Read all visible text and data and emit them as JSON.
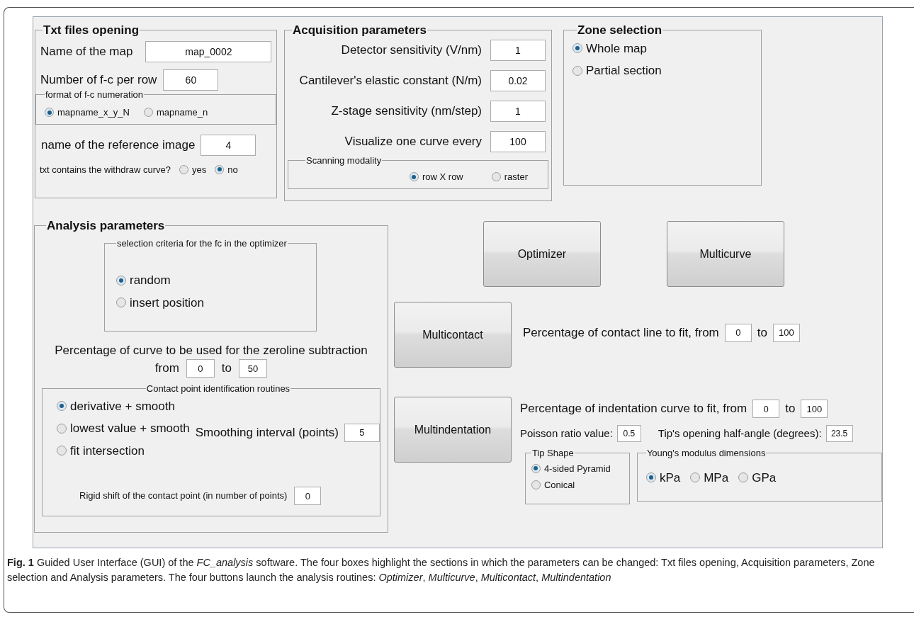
{
  "txt_files": {
    "title": "Txt files opening",
    "map_name": {
      "label": "Name of the map",
      "value": "map_0002"
    },
    "per_row": {
      "label": "Number of f-c per row",
      "value": "60"
    },
    "numeration": {
      "title": "format of f-c numeration",
      "options": [
        {
          "label": "mapname_x_y_N",
          "selected": true
        },
        {
          "label": "mapname_n",
          "selected": false
        }
      ]
    },
    "reference": {
      "label": "name of the reference image",
      "value": "4"
    },
    "withdraw": {
      "label": "txt contains the withdraw curve?",
      "options": [
        {
          "label": "yes",
          "selected": false
        },
        {
          "label": "no",
          "selected": true
        }
      ]
    }
  },
  "acquisition": {
    "title": "Acquisition parameters",
    "fields": [
      {
        "label": "Detector sensitivity (V/nm)",
        "value": "1"
      },
      {
        "label": "Cantilever's elastic constant (N/m)",
        "value": "0.02"
      },
      {
        "label": "Z-stage sensitivity (nm/step)",
        "value": "1"
      },
      {
        "label": "Visualize one curve every",
        "value": "100"
      }
    ],
    "scanning": {
      "title": "Scanning modality",
      "options": [
        {
          "label": "row X row",
          "selected": true
        },
        {
          "label": "raster",
          "selected": false
        }
      ]
    }
  },
  "zone": {
    "title": "Zone selection",
    "options": [
      {
        "label": "Whole map",
        "selected": true
      },
      {
        "label": "Partial section",
        "selected": false
      }
    ]
  },
  "analysis": {
    "title": "Analysis parameters",
    "criteria": {
      "title": "selection criteria for the fc in the optimizer",
      "options": [
        {
          "label": "random",
          "selected": true
        },
        {
          "label": "insert position",
          "selected": false
        }
      ]
    },
    "zeroline": {
      "label": "Percentage of curve to be used for the zeroline subtraction",
      "from_label": "from",
      "from": "0",
      "to_label": "to",
      "to": "50"
    },
    "contact": {
      "title": "Contact point identification routines",
      "options": [
        {
          "label": "derivative + smooth",
          "selected": true
        },
        {
          "label": "lowest value + smooth",
          "selected": false
        },
        {
          "label": "fit intersection",
          "selected": false
        }
      ],
      "smoothing": {
        "label": "Smoothing interval (points)",
        "value": "5"
      },
      "shift": {
        "label": "Rigid shift of the contact point (in number of points)",
        "value": "0"
      }
    }
  },
  "buttons": {
    "optimizer": "Optimizer",
    "multicurve": "Multicurve",
    "multicontact": "Multicontact",
    "multindentation": "Multindentation"
  },
  "contact_fit": {
    "label": "Percentage of contact line to fit, from",
    "from": "0",
    "to_label": "to",
    "to": "100"
  },
  "indentation": {
    "fit": {
      "label": "Percentage of indentation curve to fit, from",
      "from": "0",
      "to_label": "to",
      "to": "100"
    },
    "poisson": {
      "label": "Poisson ratio value:",
      "value": "0.5"
    },
    "angle": {
      "label": "Tip's opening half-angle (degrees):",
      "value": "23.5"
    },
    "tip_shape": {
      "title": "Tip Shape",
      "options": [
        {
          "label": "4-sided Pyramid",
          "selected": true
        },
        {
          "label": "Conical",
          "selected": false
        }
      ]
    },
    "modulus": {
      "title": "Young's modulus dimensions",
      "options": [
        {
          "label": "kPa",
          "selected": true
        },
        {
          "label": "MPa",
          "selected": false
        },
        {
          "label": "GPa",
          "selected": false
        }
      ]
    }
  },
  "caption": "**Fig. 1** Guided User Interface (GUI) of the *FC_analysis* software. The four boxes highlight the sections in which the parameters can be changed: Txt files opening, Acquisition parameters, Zone selection and Analysis parameters. The four buttons launch the analysis routines: *Optimizer*, *Multicurve*, *Multicontact*, *Multindentation*"
}
